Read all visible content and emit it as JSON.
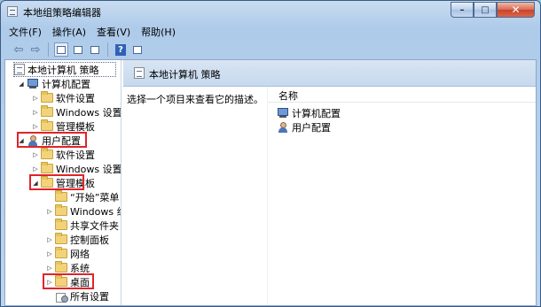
{
  "window": {
    "title": "本地组策略编辑器"
  },
  "menu": [
    "文件(F)",
    "操作(A)",
    "查看(V)",
    "帮助(H)"
  ],
  "toolbar": {
    "back_glyph": "⇦",
    "forward_glyph": "⇨",
    "help_glyph": "?"
  },
  "tree": {
    "items": [
      {
        "label": "本地计算机 策略",
        "icon": "policy-doc-icon"
      },
      {
        "label": "计算机配置",
        "icon": "computer-icon"
      },
      {
        "label": "软件设置",
        "icon": "folder-icon"
      },
      {
        "label": "Windows 设置",
        "icon": "folder-icon"
      },
      {
        "label": "管理模板",
        "icon": "folder-icon"
      },
      {
        "label": "用户配置",
        "icon": "user-icon"
      },
      {
        "label": "软件设置",
        "icon": "folder-icon"
      },
      {
        "label": "Windows 设置",
        "icon": "folder-icon"
      },
      {
        "label": "管理模板",
        "icon": "folder-icon"
      },
      {
        "label": "“开始”菜单",
        "icon": "folder-icon"
      },
      {
        "label": "Windows 组件",
        "icon": "folder-icon"
      },
      {
        "label": "共享文件夹",
        "icon": "folder-icon"
      },
      {
        "label": "控制面板",
        "icon": "folder-icon"
      },
      {
        "label": "网络",
        "icon": "folder-icon"
      },
      {
        "label": "系统",
        "icon": "folder-icon"
      },
      {
        "label": "桌面",
        "icon": "folder-icon"
      },
      {
        "label": "所有设置",
        "icon": "settings-icon"
      }
    ]
  },
  "right_pane": {
    "header_title": "本地计算机 策略",
    "description": "选择一个项目来查看它的描述。",
    "column_name": "名称",
    "items": [
      {
        "label": "计算机配置",
        "icon": "computer-icon"
      },
      {
        "label": "用户配置",
        "icon": "user-icon"
      }
    ]
  },
  "colors": {
    "highlight_border": "#e0242a",
    "header_bg": "#c6d9ee"
  }
}
